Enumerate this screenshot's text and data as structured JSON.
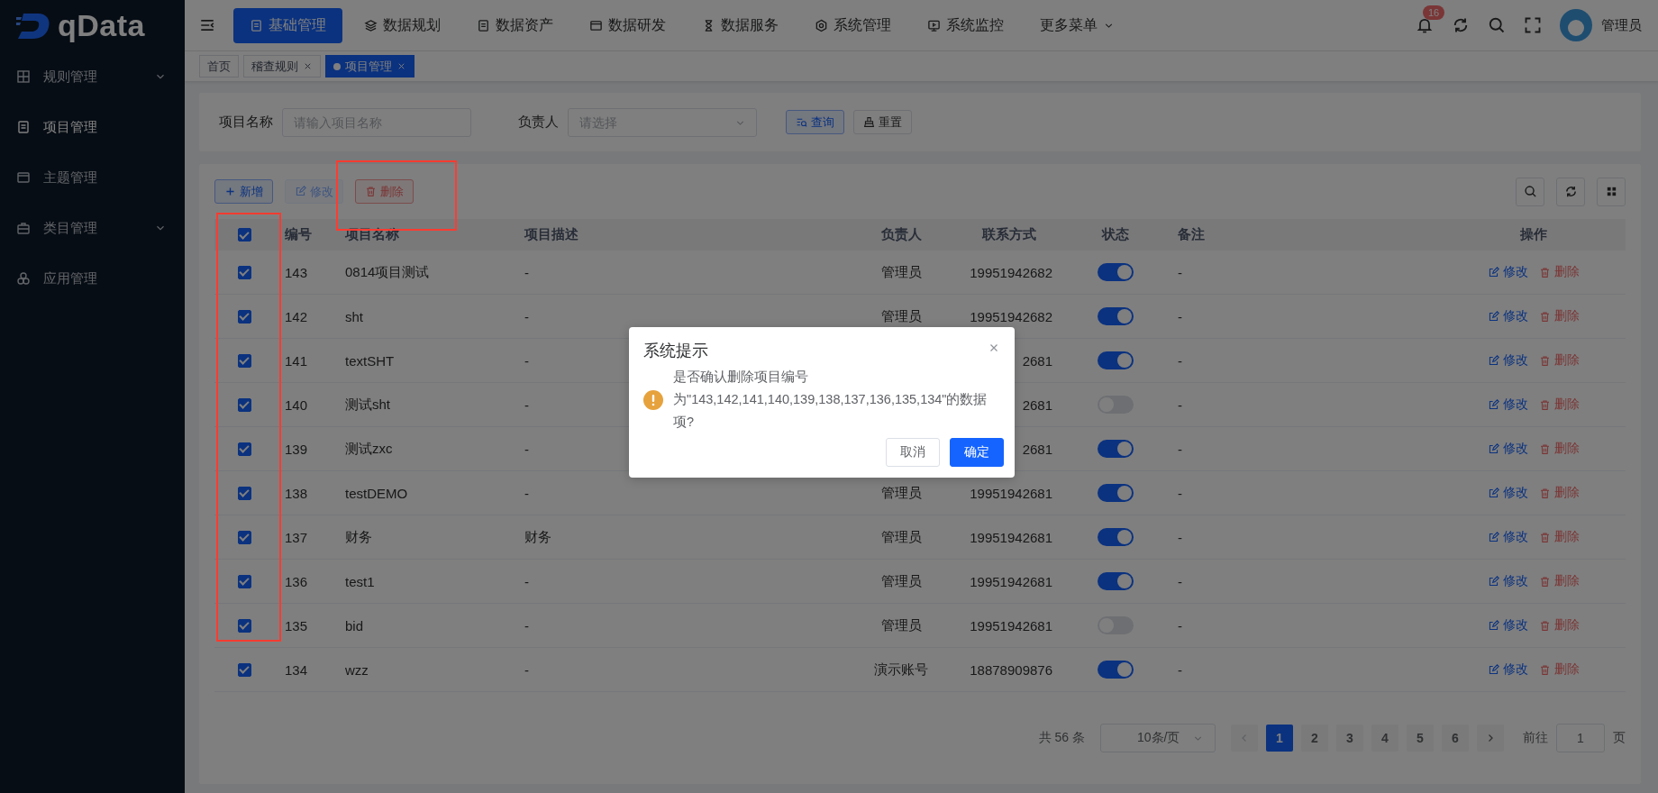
{
  "sidebar": {
    "logo": "qData",
    "items": [
      {
        "label": "规则管理",
        "expandable": true,
        "selected": false
      },
      {
        "label": "项目管理",
        "expandable": false,
        "selected": true
      },
      {
        "label": "主题管理",
        "expandable": false,
        "selected": false
      },
      {
        "label": "类目管理",
        "expandable": true,
        "selected": false
      },
      {
        "label": "应用管理",
        "expandable": false,
        "selected": false
      }
    ]
  },
  "header": {
    "nav": [
      {
        "label": "基础管理",
        "selected": true,
        "dropdown": false
      },
      {
        "label": "数据规划",
        "selected": false,
        "dropdown": false
      },
      {
        "label": "数据资产",
        "selected": false,
        "dropdown": false
      },
      {
        "label": "数据研发",
        "selected": false,
        "dropdown": false
      },
      {
        "label": "数据服务",
        "selected": false,
        "dropdown": false
      },
      {
        "label": "系统管理",
        "selected": false,
        "dropdown": false
      },
      {
        "label": "系统监控",
        "selected": false,
        "dropdown": false
      },
      {
        "label": "更多菜单",
        "selected": false,
        "dropdown": true
      }
    ],
    "notifications": "16",
    "user": "管理员"
  },
  "tags": [
    {
      "label": "首页",
      "closable": false,
      "selected": false
    },
    {
      "label": "稽查规则",
      "closable": true,
      "selected": false
    },
    {
      "label": "项目管理",
      "closable": true,
      "selected": true
    }
  ],
  "filter": {
    "fields": [
      {
        "kind": "input",
        "label": "项目名称",
        "placeholder": "请输入项目名称"
      },
      {
        "kind": "select",
        "label": "负责人",
        "placeholder": "请选择"
      }
    ],
    "buttons": [
      {
        "label": "查询",
        "kind": "primary"
      },
      {
        "label": "重置",
        "kind": "default"
      }
    ]
  },
  "toolbar": {
    "buttons": [
      {
        "label": "新增",
        "kind": "add",
        "disabled": false
      },
      {
        "label": "修改",
        "kind": "edit",
        "disabled": true
      },
      {
        "label": "删除",
        "kind": "delete",
        "disabled": false
      }
    ]
  },
  "table": {
    "header_checked": true,
    "columns": [
      "编号",
      "项目名称",
      "项目描述",
      "负责人",
      "联系方式",
      "状态",
      "备注",
      "操作"
    ],
    "rows": [
      {
        "checked": true,
        "id": "143",
        "name": "0814项目测试",
        "description": "-",
        "owner": "管理员",
        "phone": "19951942682",
        "status_on": true,
        "remark": "-",
        "actions": [
          {
            "label": "修改",
            "kind": "edit"
          },
          {
            "label": "删除",
            "kind": "delete"
          }
        ]
      },
      {
        "checked": true,
        "id": "142",
        "name": "sht",
        "description": "-",
        "owner": "管理员",
        "phone": "19951942682",
        "status_on": true,
        "remark": "-",
        "actions": [
          {
            "label": "修改",
            "kind": "edit"
          },
          {
            "label": "删除",
            "kind": "delete"
          }
        ]
      },
      {
        "checked": true,
        "id": "141",
        "name": "textSHT",
        "description": "-",
        "phone": "2681",
        "status_on": true,
        "remark": "-",
        "actions": [
          {
            "label": "修改",
            "kind": "edit"
          },
          {
            "label": "删除",
            "kind": "delete"
          }
        ]
      },
      {
        "checked": true,
        "id": "140",
        "name": "测试sht",
        "description": "-",
        "phone": "2681",
        "status_on": false,
        "remark": "-",
        "actions": [
          {
            "label": "修改",
            "kind": "edit"
          },
          {
            "label": "删除",
            "kind": "delete"
          }
        ]
      },
      {
        "checked": true,
        "id": "139",
        "name": "测试zxc",
        "description": "-",
        "phone": "2681",
        "status_on": true,
        "remark": "-",
        "actions": [
          {
            "label": "修改",
            "kind": "edit"
          },
          {
            "label": "删除",
            "kind": "delete"
          }
        ]
      },
      {
        "checked": true,
        "id": "138",
        "name": "testDEMO",
        "description": "-",
        "owner": "管理员",
        "phone": "19951942681",
        "status_on": true,
        "remark": "-",
        "actions": [
          {
            "label": "修改",
            "kind": "edit"
          },
          {
            "label": "删除",
            "kind": "delete"
          }
        ]
      },
      {
        "checked": true,
        "id": "137",
        "name": "财务",
        "description": "财务",
        "owner": "管理员",
        "phone": "19951942681",
        "status_on": true,
        "remark": "-",
        "actions": [
          {
            "label": "修改",
            "kind": "edit"
          },
          {
            "label": "删除",
            "kind": "delete"
          }
        ]
      },
      {
        "checked": true,
        "id": "136",
        "name": "test1",
        "description": "-",
        "owner": "管理员",
        "phone": "19951942681",
        "status_on": true,
        "remark": "-",
        "actions": [
          {
            "label": "修改",
            "kind": "edit"
          },
          {
            "label": "删除",
            "kind": "delete"
          }
        ]
      },
      {
        "checked": true,
        "id": "135",
        "name": "bid",
        "description": "-",
        "owner": "管理员",
        "phone": "19951942681",
        "status_on": false,
        "remark": "-",
        "actions": [
          {
            "label": "修改",
            "kind": "edit"
          },
          {
            "label": "删除",
            "kind": "delete"
          }
        ]
      },
      {
        "checked": true,
        "id": "134",
        "name": "wzz",
        "description": "-",
        "owner": "演示账号",
        "phone": "18878909876",
        "status_on": true,
        "remark": "-",
        "actions": [
          {
            "label": "修改",
            "kind": "edit"
          },
          {
            "label": "删除",
            "kind": "delete"
          }
        ]
      }
    ]
  },
  "pagination": {
    "total": "共 56 条",
    "page_size": "10条/页",
    "pages": [
      {
        "label": "1",
        "selected": true
      },
      {
        "label": "2",
        "selected": false
      },
      {
        "label": "3",
        "selected": false
      },
      {
        "label": "4",
        "selected": false
      },
      {
        "label": "5",
        "selected": false
      },
      {
        "label": "6",
        "selected": false
      }
    ],
    "goto_label": "前往",
    "goto_value": "1",
    "goto_suffix": "页"
  },
  "dialog": {
    "title": "系统提示",
    "message": "是否确认删除项目编号为\"143,142,141,140,139,138,137,136,135,134\"的数据项?",
    "buttons": [
      {
        "label": "取消",
        "kind": "default"
      },
      {
        "label": "确定",
        "kind": "primary"
      }
    ]
  }
}
